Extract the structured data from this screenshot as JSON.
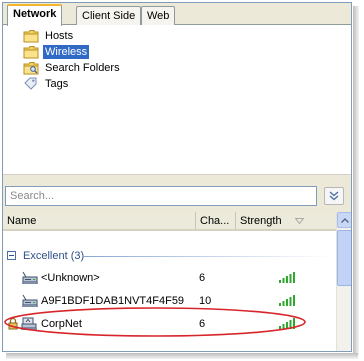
{
  "tabs": [
    {
      "label": "Network",
      "active": true
    },
    {
      "label": "Client Side",
      "active": false
    },
    {
      "label": "Web",
      "active": false
    }
  ],
  "tree": {
    "items": [
      {
        "label": "Hosts",
        "icon": "folder-icon",
        "selected": false
      },
      {
        "label": "Wireless",
        "icon": "folder-icon",
        "selected": true
      },
      {
        "label": "Search Folders",
        "icon": "search-folder-icon",
        "selected": false
      },
      {
        "label": "Tags",
        "icon": "tag-icon",
        "selected": false
      }
    ]
  },
  "search": {
    "placeholder": "Search..."
  },
  "list": {
    "columns": {
      "name": "Name",
      "channel": "Cha...",
      "strength": "Strength"
    },
    "groups": [
      {
        "label": "Excellent (3)",
        "expanded": true,
        "rows": [
          {
            "name": "<Unknown>",
            "channel": "6",
            "strength_bars": 5,
            "icon": "access-point-icon",
            "locked": false
          },
          {
            "name": "A9F1BDF1DAB1NVT4F4F59",
            "channel": "10",
            "strength_bars": 5,
            "icon": "access-point-icon",
            "locked": false
          },
          {
            "name": "CorpNet",
            "channel": "6",
            "strength_bars": 5,
            "icon": "access-point-icon",
            "locked": true,
            "highlighted": true
          }
        ]
      }
    ]
  },
  "colors": {
    "selection": "#316ac5",
    "tab_accent": "#f7b52b",
    "group_text": "#2f4f89",
    "signal": "#2fa82f",
    "highlight_ring": "#d7262b"
  }
}
